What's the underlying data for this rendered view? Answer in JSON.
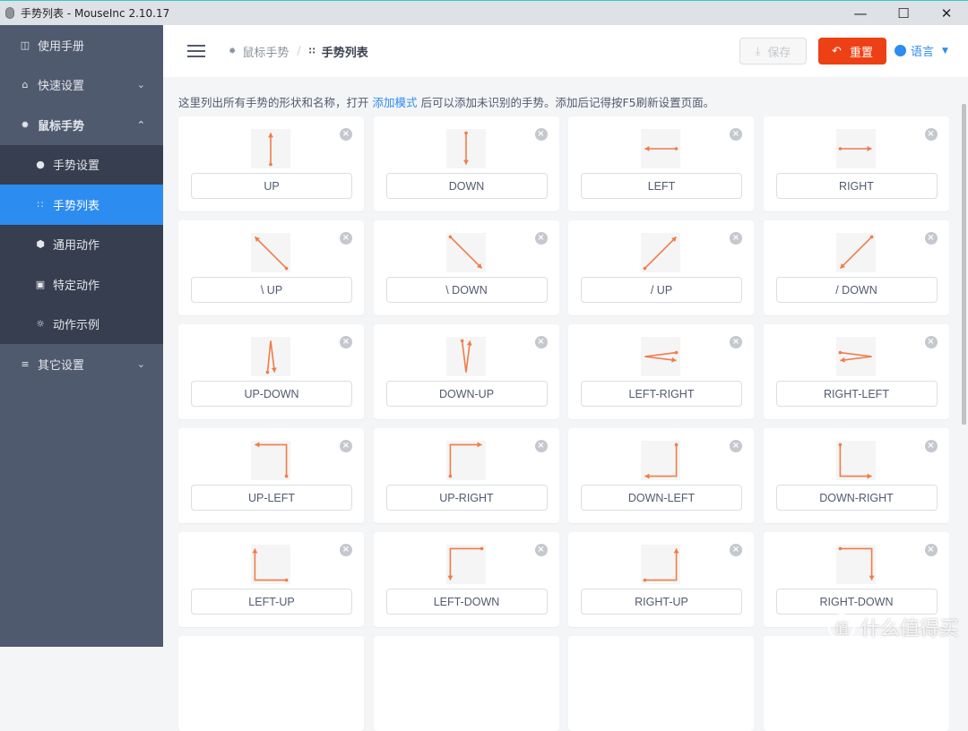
{
  "window": {
    "title": "手势列表 - MouseInc 2.10.17",
    "controls": [
      "minimize",
      "maximize",
      "close"
    ]
  },
  "sidebar": {
    "items": [
      {
        "label": "使用手册",
        "icon": "book-icon"
      },
      {
        "label": "快速设置",
        "icon": "home-icon",
        "chevron": "down"
      },
      {
        "label": "鼠标手势",
        "icon": "gear-icon",
        "chevron": "up",
        "expanded": true
      }
    ],
    "submenu": [
      {
        "label": "手势设置",
        "icon": "palette-icon"
      },
      {
        "label": "手势列表",
        "icon": "grid-icon",
        "active": true
      },
      {
        "label": "通用动作",
        "icon": "cube-icon"
      },
      {
        "label": "特定动作",
        "icon": "lock-icon"
      },
      {
        "label": "动作示例",
        "icon": "bulb-icon"
      }
    ],
    "bottom_items": [
      {
        "label": "其它设置",
        "icon": "sliders-icon",
        "chevron": "down"
      }
    ]
  },
  "header": {
    "breadcrumb": [
      {
        "label": "鼠标手势",
        "icon": "gear-icon"
      },
      {
        "label": "手势列表",
        "icon": "grid-icon"
      }
    ],
    "save_label": "保存",
    "reset_label": "重置",
    "language_label": "语言"
  },
  "info": {
    "before": "这里列出所有手势的形状和名称，打开 ",
    "link": "添加模式",
    "after": " 后可以添加未识别的手势。添加后记得按F5刷新设置页面。"
  },
  "accent_color": "#ed7d4a",
  "gestures": [
    {
      "name": "UP",
      "path": [
        [
          0.5,
          0.9
        ],
        [
          0.5,
          0.1
        ]
      ]
    },
    {
      "name": "DOWN",
      "path": [
        [
          0.5,
          0.1
        ],
        [
          0.5,
          0.9
        ]
      ]
    },
    {
      "name": "LEFT",
      "path": [
        [
          0.9,
          0.5
        ],
        [
          0.1,
          0.5
        ]
      ]
    },
    {
      "name": "RIGHT",
      "path": [
        [
          0.1,
          0.5
        ],
        [
          0.9,
          0.5
        ]
      ]
    },
    {
      "name": "\\ UP",
      "path": [
        [
          0.9,
          0.9
        ],
        [
          0.1,
          0.1
        ]
      ]
    },
    {
      "name": "\\ DOWN",
      "path": [
        [
          0.1,
          0.1
        ],
        [
          0.9,
          0.9
        ]
      ]
    },
    {
      "name": "/ UP",
      "path": [
        [
          0.1,
          0.9
        ],
        [
          0.9,
          0.1
        ]
      ]
    },
    {
      "name": "/ DOWN",
      "path": [
        [
          0.9,
          0.1
        ],
        [
          0.1,
          0.9
        ]
      ]
    },
    {
      "name": "UP-DOWN",
      "path": [
        [
          0.42,
          0.9
        ],
        [
          0.5,
          0.1
        ],
        [
          0.6,
          0.9
        ]
      ]
    },
    {
      "name": "DOWN-UP",
      "path": [
        [
          0.4,
          0.1
        ],
        [
          0.5,
          0.9
        ],
        [
          0.6,
          0.1
        ]
      ]
    },
    {
      "name": "LEFT-RIGHT",
      "path": [
        [
          0.9,
          0.4
        ],
        [
          0.1,
          0.5
        ],
        [
          0.9,
          0.6
        ]
      ]
    },
    {
      "name": "RIGHT-LEFT",
      "path": [
        [
          0.1,
          0.4
        ],
        [
          0.9,
          0.5
        ],
        [
          0.1,
          0.6
        ]
      ]
    },
    {
      "name": "UP-LEFT",
      "path": [
        [
          0.9,
          0.9
        ],
        [
          0.9,
          0.1
        ],
        [
          0.1,
          0.1
        ]
      ]
    },
    {
      "name": "UP-RIGHT",
      "path": [
        [
          0.1,
          0.9
        ],
        [
          0.1,
          0.1
        ],
        [
          0.9,
          0.1
        ]
      ]
    },
    {
      "name": "DOWN-LEFT",
      "path": [
        [
          0.9,
          0.1
        ],
        [
          0.9,
          0.9
        ],
        [
          0.1,
          0.9
        ]
      ]
    },
    {
      "name": "DOWN-RIGHT",
      "path": [
        [
          0.1,
          0.1
        ],
        [
          0.1,
          0.9
        ],
        [
          0.9,
          0.9
        ]
      ]
    },
    {
      "name": "LEFT-UP",
      "path": [
        [
          0.9,
          0.9
        ],
        [
          0.1,
          0.9
        ],
        [
          0.1,
          0.1
        ]
      ]
    },
    {
      "name": "LEFT-DOWN",
      "path": [
        [
          0.9,
          0.1
        ],
        [
          0.1,
          0.1
        ],
        [
          0.1,
          0.9
        ]
      ]
    },
    {
      "name": "RIGHT-UP",
      "path": [
        [
          0.1,
          0.9
        ],
        [
          0.9,
          0.9
        ],
        [
          0.9,
          0.1
        ]
      ]
    },
    {
      "name": "RIGHT-DOWN",
      "path": [
        [
          0.1,
          0.1
        ],
        [
          0.9,
          0.1
        ],
        [
          0.9,
          0.9
        ]
      ]
    },
    {
      "name": "",
      "path": []
    },
    {
      "name": "",
      "path": []
    },
    {
      "name": "",
      "path": []
    },
    {
      "name": "",
      "path": []
    }
  ],
  "watermark": "什么值得买"
}
